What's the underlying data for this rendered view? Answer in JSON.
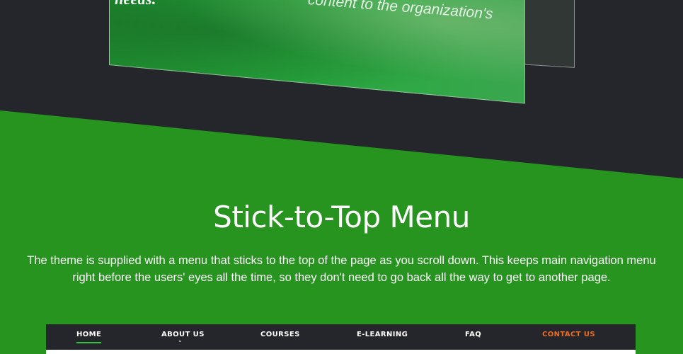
{
  "hero_panel": {
    "text_left": "needs.",
    "text_right": "content to the organization's"
  },
  "section": {
    "title": "Stick-to-Top Menu",
    "description": "The theme is supplied with a menu that sticks to the top of the page as you scroll down. This keeps main navigation menu right before the users' eyes all the time, so they don't need to go back all the way to get to another page."
  },
  "menu": {
    "items": [
      {
        "label": "HOME",
        "active": true
      },
      {
        "label": "ABOUT US",
        "has_dropdown": true
      },
      {
        "label": "COURSES"
      },
      {
        "label": "E-LEARNING"
      },
      {
        "label": "FAQ"
      },
      {
        "label": "CONTACT US",
        "highlight_color": "#ec6d23"
      }
    ],
    "active_indicator_color": "#34c43c"
  },
  "colors": {
    "dark_background": "#25262b",
    "green_section": "#26941f",
    "accent_orange": "#ec6d23"
  }
}
